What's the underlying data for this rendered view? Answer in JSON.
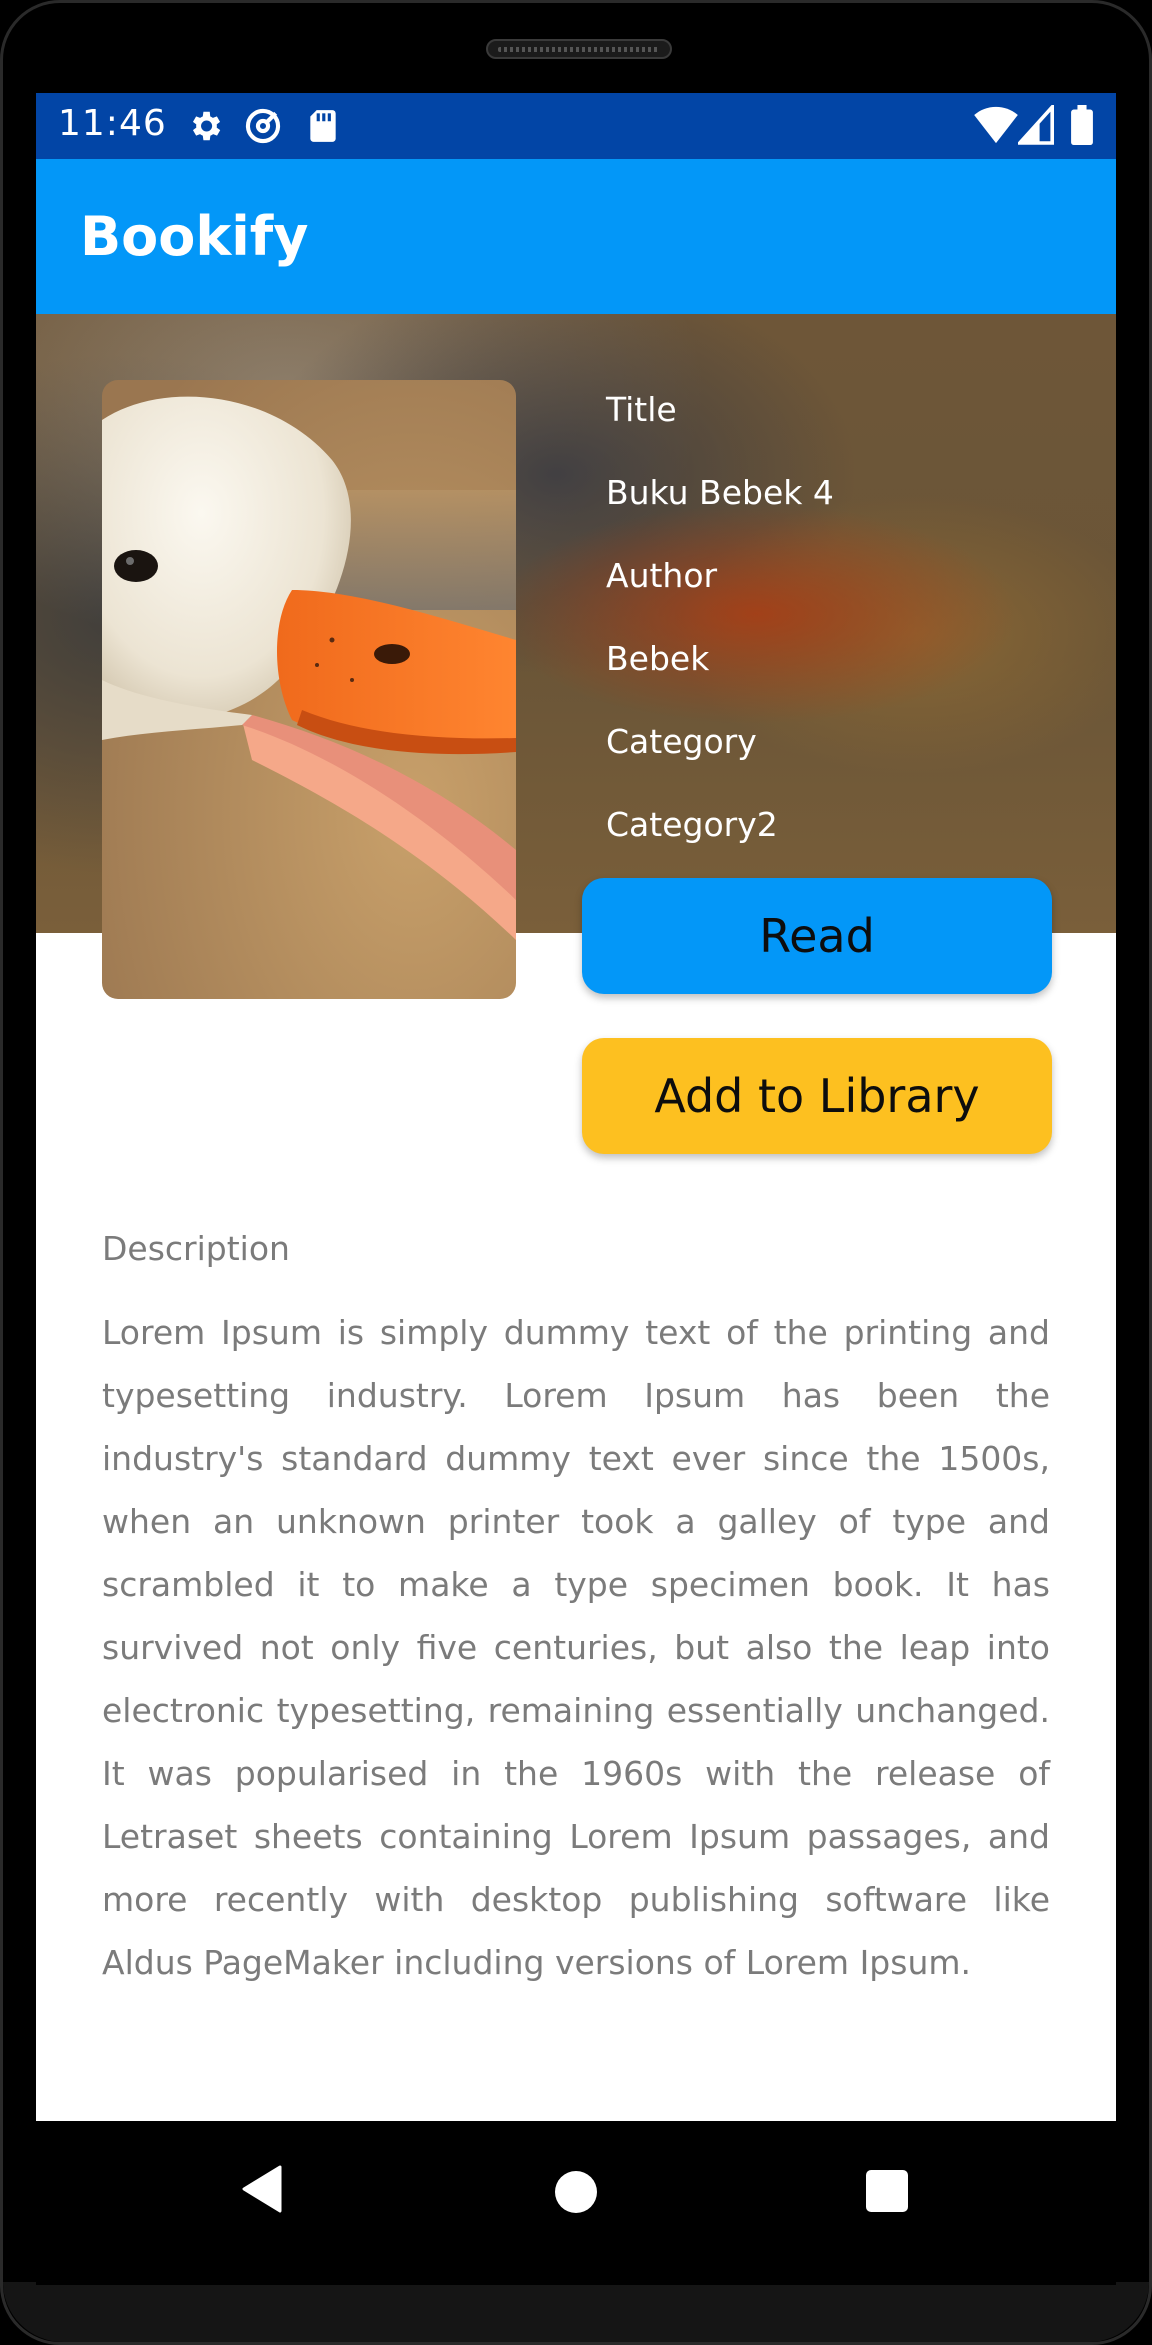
{
  "status_bar": {
    "time": "11:46",
    "icons_left": [
      "gear-icon",
      "at-sign-icon",
      "sd-card-icon"
    ],
    "icons_right": [
      "wifi-icon",
      "signal-icon",
      "battery-icon"
    ],
    "color": "#0245a6"
  },
  "app_bar": {
    "title": "Bookify",
    "color": "#0397f8"
  },
  "book": {
    "cover_image": "white duck with orange beak",
    "title_label": "Title",
    "title_value": "Buku Bebek 4",
    "author_label": "Author",
    "author_value": "Bebek",
    "category_label": "Category",
    "category_value": "Category2"
  },
  "actions": {
    "read_label": "Read",
    "read_color": "#0397f8",
    "library_label": "Add to Library",
    "library_color": "#fdc020"
  },
  "description": {
    "label": "Description",
    "text": "Lorem Ipsum is simply dummy text of the printing and typesetting industry. Lorem Ipsum has been the industry's standard dummy text ever since the 1500s, when an unknown printer took a galley of type and scrambled it to make a type specimen book. It has survived not only five centuries, but also the leap into electronic typesetting, remaining essentially unchanged. It was popularised in the 1960s with the release of Letraset sheets containing Lorem Ipsum passages, and more recently with desktop publishing software like Aldus PageMaker including versions of Lorem Ipsum."
  },
  "nav_bar": {
    "items": [
      "back-icon",
      "home-icon",
      "recents-icon"
    ]
  }
}
